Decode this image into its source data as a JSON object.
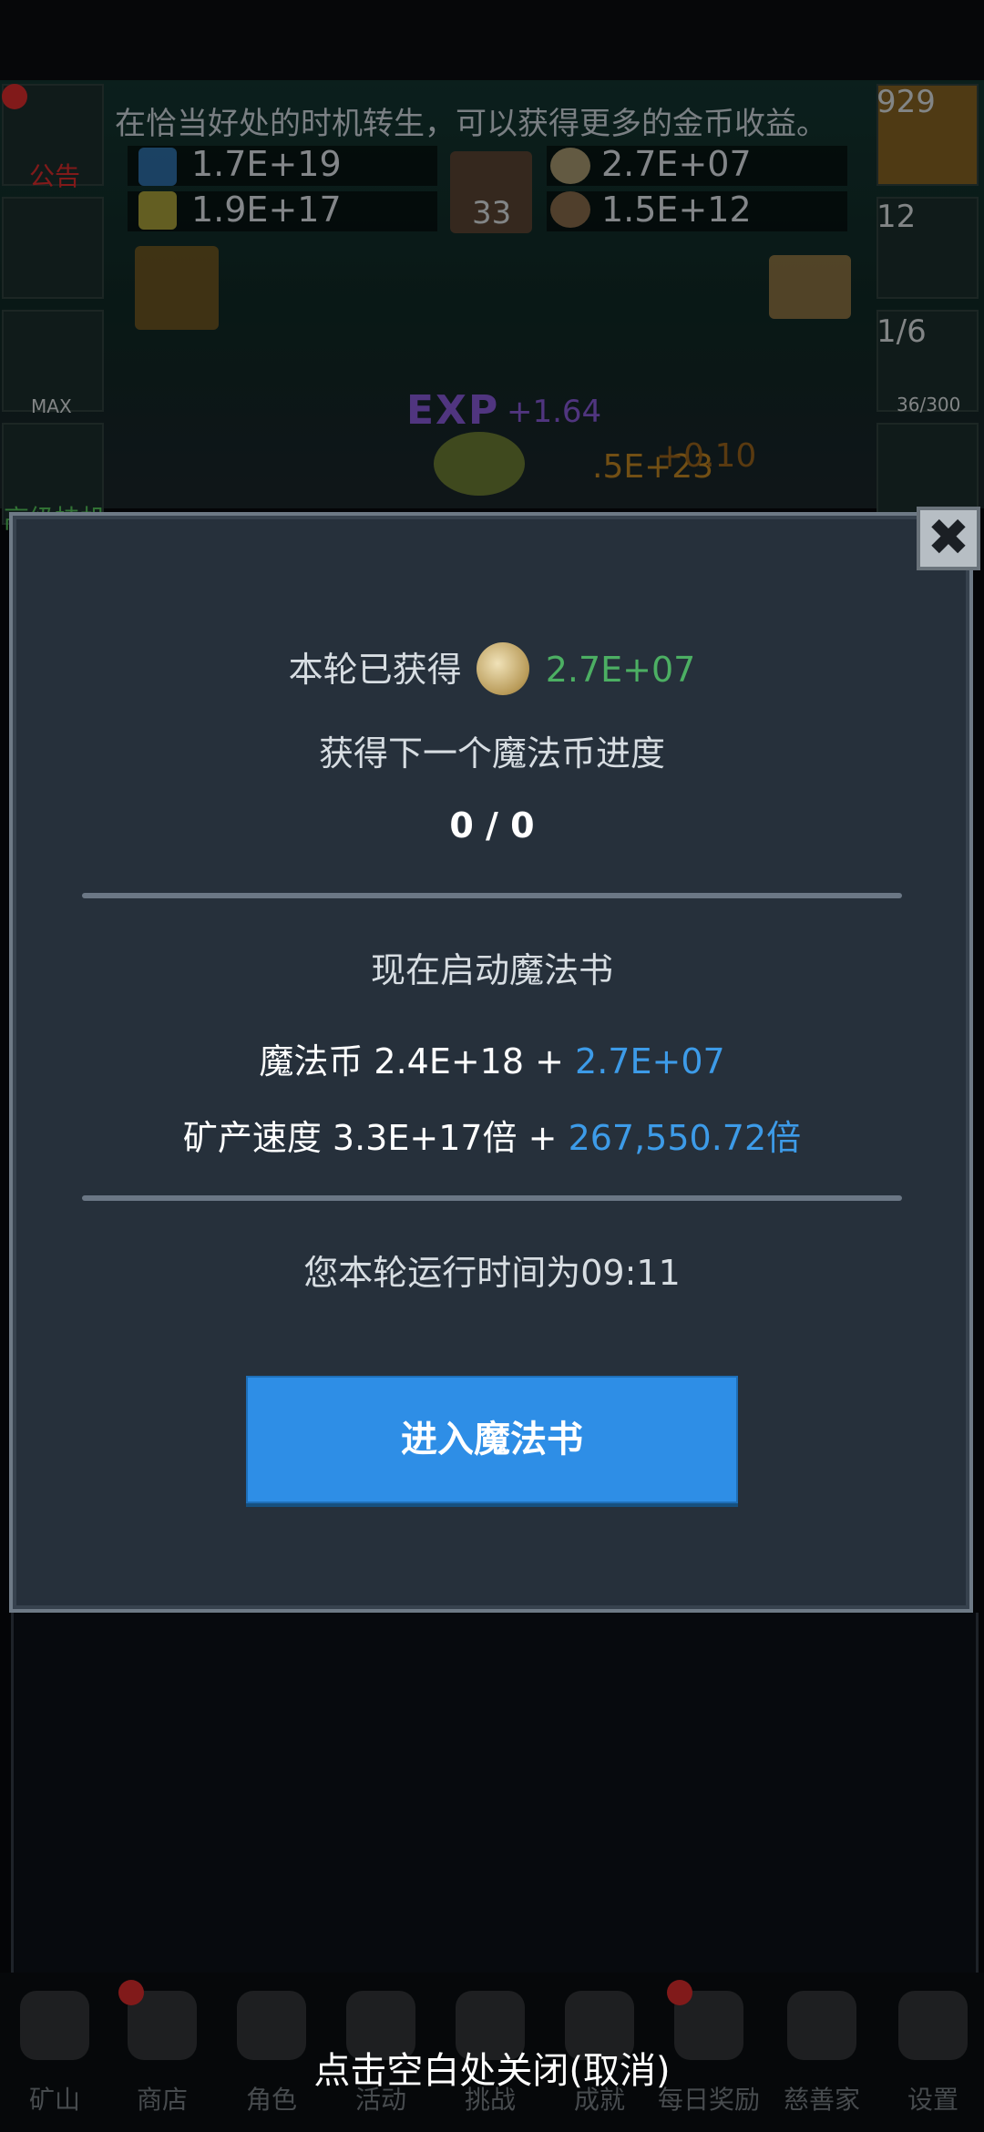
{
  "background": {
    "tip": "在恰当好处的时机转生，可以获得更多的金币收益。",
    "resources": [
      {
        "value": "1.7E+19",
        "icon": "blue-potion-icon"
      },
      {
        "value": "1.9E+17",
        "icon": "yellow-potion-icon"
      },
      {
        "value": "2.7E+07",
        "icon": "coin-icon"
      },
      {
        "value": "1.5E+12",
        "icon": "ore-icon"
      }
    ],
    "book_count": "33",
    "left_side": {
      "notice_label": "公告",
      "max_label": "MAX",
      "partial_label": "高级挂机"
    },
    "right_side": {
      "potion_count": "929",
      "chest_count": "12",
      "slime_count": "1/6",
      "slime_progress": "36/300"
    },
    "exp_label": "EXP",
    "exp_value": "+1.64",
    "gold_float": ".5E+23",
    "gold_float_2": "+0.10"
  },
  "dialog": {
    "earned_label": "本轮已获得",
    "earned_value": "2.7E+07",
    "progress_label": "获得下一个魔法币进度",
    "progress_value": "0 / 0",
    "start_label": "现在启动魔法书",
    "magic_coin_label": "魔法币 2.4E+18 + ",
    "magic_coin_gain": "2.7E+07",
    "mining_speed_label": "矿产速度 3.3E+17倍 + ",
    "mining_speed_gain": "267,550.72倍",
    "runtime_text": "您本轮运行时间为09:11",
    "enter_button": "进入魔法书",
    "close_symbol": "✖",
    "colors": {
      "green": "#4caf63",
      "blue": "#3d9be8",
      "button": "#2e8ee6"
    }
  },
  "nav": {
    "items": [
      {
        "label": "矿山",
        "icon": "lantern-icon"
      },
      {
        "label": "商店",
        "icon": "shop-icon"
      },
      {
        "label": "角色",
        "icon": "skull-icon"
      },
      {
        "label": "活动",
        "icon": "scroll-icon"
      },
      {
        "label": "挑战",
        "icon": "challenge-icon"
      },
      {
        "label": "成就",
        "icon": "key-icon"
      },
      {
        "label": "每日奖励",
        "icon": "letter-icon"
      },
      {
        "label": "慈善家",
        "icon": "bread-icon"
      },
      {
        "label": "设置",
        "icon": "gear-icon"
      }
    ]
  },
  "hint": "点击空白处关闭(取消)"
}
